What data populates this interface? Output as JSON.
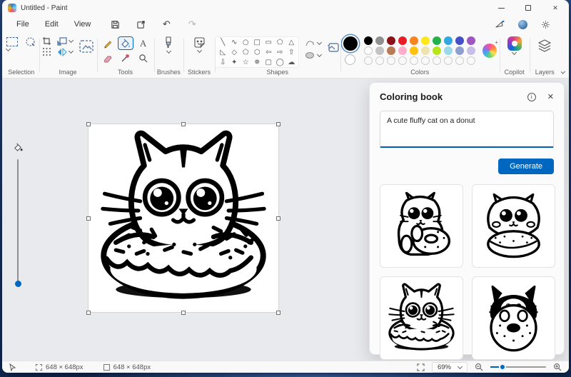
{
  "window": {
    "title": "Untitled - Paint"
  },
  "menubar": {
    "items": [
      "File",
      "Edit",
      "View"
    ],
    "undo_glyph": "↶",
    "redo_glyph": "↷"
  },
  "ribbon": {
    "groups": {
      "selection": "Selection",
      "image": "Image",
      "tools": "Tools",
      "brushes": "Brushes",
      "stickers": "Stickers",
      "shapes": "Shapes",
      "colors": "Colors",
      "copilot": "Copilot",
      "layers": "Layers"
    },
    "shapes_rows": [
      [
        "╲",
        "∿",
        "○",
        "□",
        "▭",
        "⬠",
        "△"
      ],
      [
        "◺",
        "◇",
        "⬠",
        "⬡",
        "⇦",
        "⇨",
        "⇧"
      ],
      [
        "⇩",
        "✦",
        "☆",
        "✵",
        "▢",
        "◯",
        "☁"
      ]
    ],
    "palette": {
      "primary": "#000000",
      "secondary": "#ffffff",
      "row1": [
        "#000000",
        "#909090",
        "#8b1216",
        "#ea1c24",
        "#f6851f",
        "#ffe81a",
        "#24b14c",
        "#2fa9e0",
        "#4350c8",
        "#9e57c1"
      ],
      "row2": [
        "#ffffff",
        "#c3c3c3",
        "#b97a57",
        "#ffaec9",
        "#ffc20e",
        "#efe4b0",
        "#b5e61d",
        "#99d9ea",
        "#8f9fd0",
        "#c8bfe7"
      ],
      "empty_count": 10
    }
  },
  "coloring_book": {
    "title": "Coloring book",
    "prompt": "A cute fluffy cat on a donut",
    "generate_label": "Generate",
    "results": [
      {
        "name": "cat-hugging-donut"
      },
      {
        "name": "fluffy-cat-on-donut"
      },
      {
        "name": "cat-head-in-donut"
      },
      {
        "name": "black-cat-behind-donut"
      }
    ]
  },
  "statusbar": {
    "selection_size": "648 × 648px",
    "canvas_size": "648 × 648px",
    "zoom_level": "69%"
  }
}
